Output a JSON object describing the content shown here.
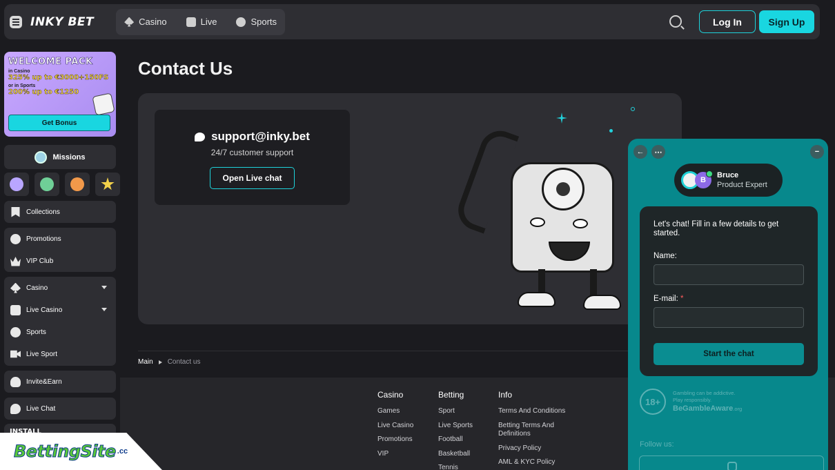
{
  "header": {
    "logo_text": "INKY BET",
    "nav": [
      {
        "label": "Casino",
        "icon": "spade-icon"
      },
      {
        "label": "Live",
        "icon": "dice-icon"
      },
      {
        "label": "Sports",
        "icon": "ball-icon"
      }
    ],
    "login_label": "Log In",
    "signup_label": "Sign Up"
  },
  "sidebar": {
    "banner": {
      "title": "WELCOME PACK",
      "line1_small": "in Casino",
      "line1_big": "325% up to €3000+150FS",
      "line2_small": "or in Sports",
      "line2_big": "200% up to €1250",
      "button": "Get Bonus"
    },
    "missions_label": "Missions",
    "collections": "Collections",
    "promotions": "Promotions",
    "vip": "VIP Club",
    "casino": "Casino",
    "live_casino": "Live Casino",
    "sports": "Sports",
    "live_sport": "Live Sport",
    "invite": "Invite&Earn",
    "live_chat": "Live Chat",
    "install": "INSTALL"
  },
  "main": {
    "title": "Contact Us",
    "support_email": "support@inky.bet",
    "support_sub": "24/7 customer support",
    "open_chat": "Open Live chat"
  },
  "breadcrumb": {
    "main": "Main",
    "current": "Contact us"
  },
  "footer": {
    "columns": [
      {
        "title": "Casino",
        "links": [
          "Games",
          "Live Casino",
          "Promotions",
          "VIP"
        ]
      },
      {
        "title": "Betting",
        "links": [
          "Sport",
          "Live Sports",
          "Football",
          "Basketball",
          "Tennis"
        ]
      },
      {
        "title": "Info",
        "links": [
          "Terms And Conditions",
          "Betting Terms And Definitions",
          "Privacy Policy",
          "AML & KYC Policy"
        ]
      }
    ]
  },
  "chat": {
    "agent_name": "Bruce",
    "agent_role": "Product Expert",
    "agent_initial": "B",
    "intro": "Let's chat! Fill in a few details to get started.",
    "name_label": "Name:",
    "email_label": "E-mail:",
    "required_mark": "*",
    "start_button": "Start the chat",
    "age": "18+",
    "gamble_line1": "Gambling can be addictive.",
    "gamble_line2": "Play responsibly.",
    "gamble_brand": "BeGambleAware",
    "gamble_brand_suffix": ".org",
    "follow_label": "Follow us:"
  },
  "watermark": {
    "text": "BettingSite",
    "suffix": ".cc"
  },
  "colors": {
    "accent": "#19d6e0",
    "chat_bg": "#07888c",
    "page_bg": "#1b1b1f",
    "panel": "#2e2e33"
  }
}
